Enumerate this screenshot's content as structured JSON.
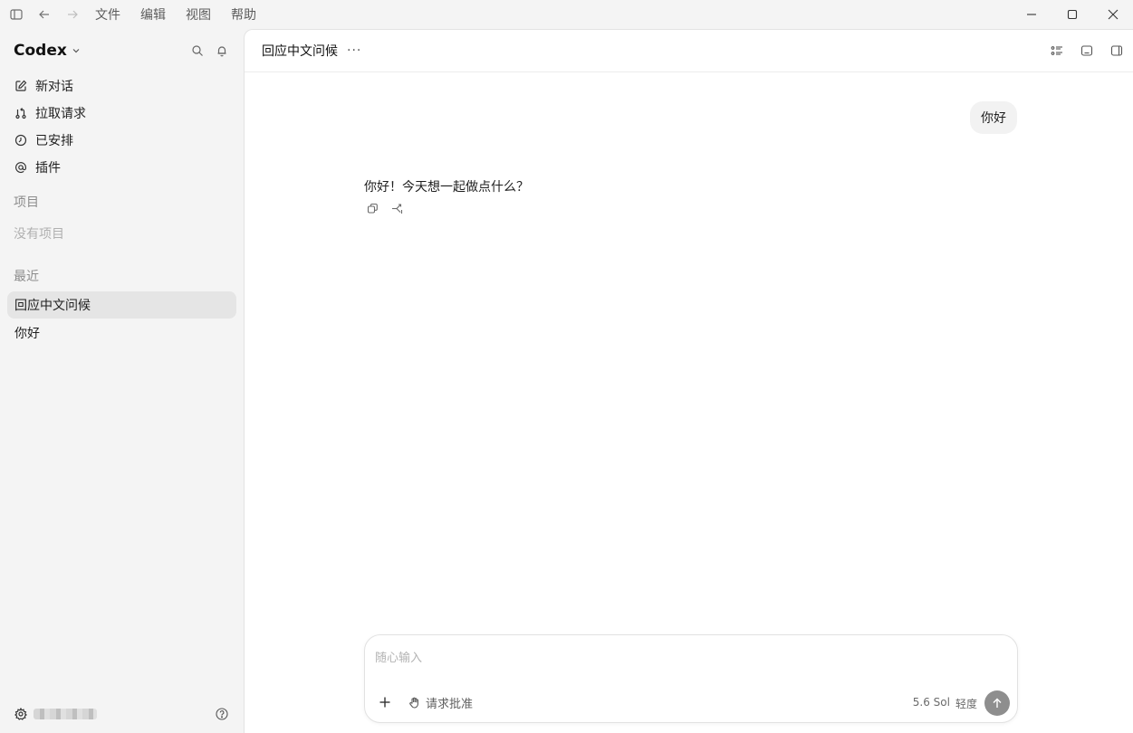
{
  "menu": [
    "文件",
    "编辑",
    "视图",
    "帮助"
  ],
  "sidebar": {
    "brand": "Codex",
    "nav": [
      {
        "label": "新对话",
        "icon": "edit-icon"
      },
      {
        "label": "拉取请求",
        "icon": "pull-request-icon"
      },
      {
        "label": "已安排",
        "icon": "clock-icon"
      },
      {
        "label": "插件",
        "icon": "at-icon"
      }
    ],
    "projects_label": "项目",
    "no_projects": "没有项目",
    "recent_label": "最近",
    "recent": [
      "回应中文问候",
      "你好"
    ],
    "active_recent": 0
  },
  "chat": {
    "title": "回应中文问候",
    "more": "···",
    "user_message": "你好",
    "assistant_message": "你好！今天想一起做点什么？"
  },
  "composer": {
    "placeholder": "随心输入",
    "approval_label": "请求批准",
    "model": "5.6 Sol",
    "effort": "轻度"
  },
  "colors": {
    "sidebar_bg": "#f4f4f4",
    "main_bg": "#ffffff",
    "active_item_bg": "#e5e5e5",
    "send_button": "#8e8e8e"
  }
}
